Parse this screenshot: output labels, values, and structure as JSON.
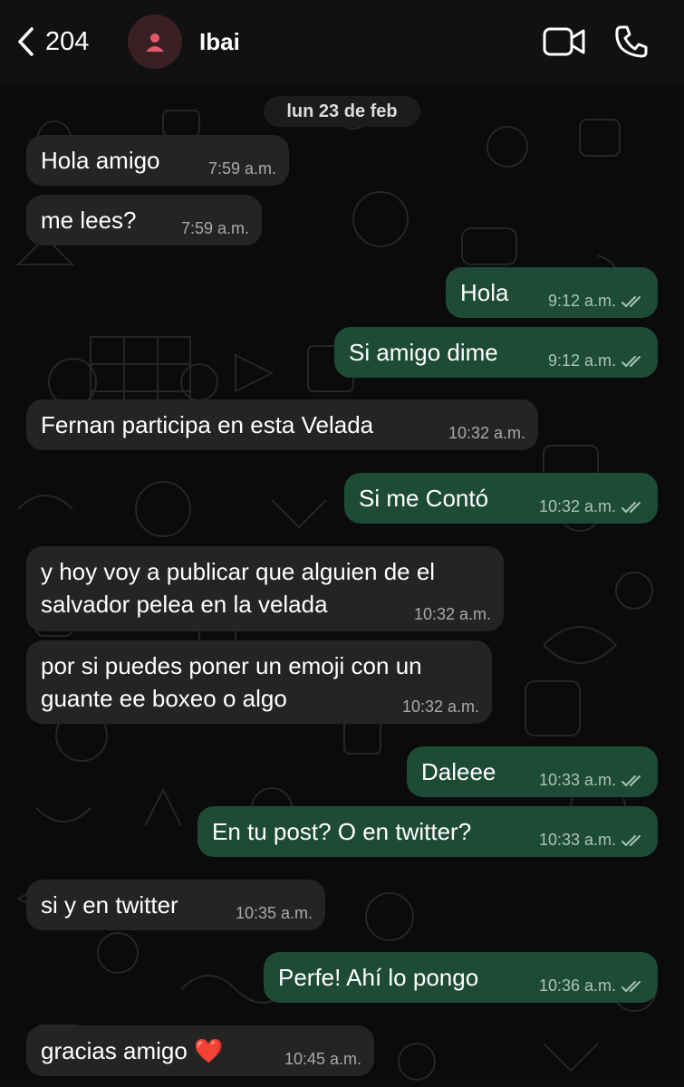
{
  "header": {
    "back_count": "204",
    "contact_name": "Ibai"
  },
  "date_separator": "lun 23 de feb",
  "messages": [
    {
      "dir": "in",
      "lines": [
        "Hola amigo"
      ],
      "time": "7:59 a.m."
    },
    {
      "dir": "in",
      "lines": [
        "me lees?"
      ],
      "time": "7:59 a.m."
    },
    {
      "dir": "out",
      "lines": [
        "Hola"
      ],
      "time": "9:12 a.m.",
      "read": true
    },
    {
      "dir": "out",
      "lines": [
        "Si amigo dime"
      ],
      "time": "9:12 a.m.",
      "read": true
    },
    {
      "dir": "in",
      "lines": [
        "Fernan participa en esta Velada"
      ],
      "time": "10:32 a.m."
    },
    {
      "dir": "out",
      "lines": [
        "Si me Contó"
      ],
      "time": "10:32 a.m.",
      "read": true
    },
    {
      "dir": "in",
      "lines": [
        "y hoy voy a publicar que alguien de el",
        "salvador pelea en la velada"
      ],
      "time": "10:32 a.m."
    },
    {
      "dir": "in",
      "lines": [
        "por si puedes poner un emoji con un",
        "guante ee boxeo o algo"
      ],
      "time": "10:32 a.m."
    },
    {
      "dir": "out",
      "lines": [
        "Daleee"
      ],
      "time": "10:33 a.m.",
      "read": true
    },
    {
      "dir": "out",
      "lines": [
        "En tu post? O en twitter?"
      ],
      "time": "10:33 a.m.",
      "read": true
    },
    {
      "dir": "in",
      "lines": [
        "si y en twitter"
      ],
      "time": "10:35 a.m."
    },
    {
      "dir": "out",
      "lines": [
        "Perfe! Ahí lo pongo"
      ],
      "time": "10:36 a.m.",
      "read": true
    },
    {
      "dir": "in",
      "lines": [
        "gracias amigo ❤️"
      ],
      "time": "10:45 a.m."
    }
  ],
  "colors": {
    "incoming_bubble": "#242424",
    "outgoing_bubble": "#1e4b37",
    "background": "#0b0b0b",
    "read_ticks": "#a8c4b5"
  }
}
